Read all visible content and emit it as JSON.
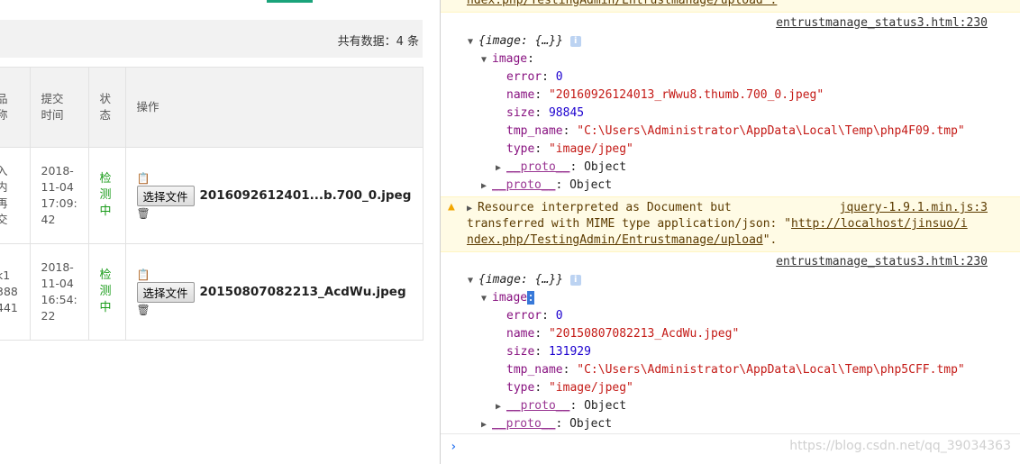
{
  "left": {
    "total": "共有数据：4 条",
    "headers": [
      {
        "l1": "品",
        "l2": "称"
      },
      {
        "l1": "提交",
        "l2": "时间"
      },
      {
        "l1": "状",
        "l2": "态"
      },
      {
        "l1": "操作"
      }
    ],
    "rows": [
      {
        "c0": [
          "入",
          "内",
          "再",
          "交"
        ],
        "time": [
          "2018-",
          "11-04",
          "17:09:",
          "42"
        ],
        "status": [
          "检",
          "测",
          "中"
        ],
        "button": "选择文件",
        "file": "2016092612401...b.700_0.jpeg"
      },
      {
        "c0": [
          "k1",
          "388",
          "441"
        ],
        "time": [
          "2018-",
          "11-04",
          "16:54:",
          "22"
        ],
        "status": [
          "检",
          "测",
          "中"
        ],
        "button": "选择文件",
        "file": "20150807082213_AcdWu.jpeg"
      }
    ]
  },
  "console": {
    "top_partial": "ndex.php/TestingAdmin/Entrustmanage/upload\".",
    "entries": [
      {
        "source": "entrustmanage_status3.html:230",
        "object_label": "{image: {…}}",
        "image_key": "image",
        "error_key": "error",
        "error": "0",
        "name_key": "name",
        "name": "\"20160926124013_rWwu8.thumb.700_0.jpeg\"",
        "size_key": "size",
        "size": "98845",
        "tmp_key": "tmp_name",
        "tmp": "\"C:\\Users\\Administrator\\AppData\\Local\\Temp\\php4F09.tmp\"",
        "type_key": "type",
        "type": "\"image/jpeg\"",
        "proto_inner": "__proto__",
        "proto_outer": "__proto__",
        "proto_value": "Object"
      },
      {
        "source": "entrustmanage_status3.html:230",
        "object_label": "{image: {…}}",
        "image_key": "image",
        "error_key": "error",
        "error": "0",
        "name_key": "name",
        "name": "\"20150807082213_AcdWu.jpeg\"",
        "size_key": "size",
        "size": "131929",
        "tmp_key": "tmp_name",
        "tmp": "\"C:\\Users\\Administrator\\AppData\\Local\\Temp\\php5CFF.tmp\"",
        "type_key": "type",
        "type": "\"image/jpeg\"",
        "proto_inner": "__proto__",
        "proto_outer": "__proto__",
        "proto_value": "Object"
      }
    ],
    "warning": {
      "line1": "Resource interpreted as Document but",
      "source": "jquery-1.9.1.min.js:3",
      "line2a": "transferred with MIME type application/json: \"",
      "link1": "http://localhost/jinsuo/i",
      "link2": "ndex.php/TestingAdmin/Entrustmanage/upload",
      "line3b": "\"."
    },
    "prompt": "›",
    "watermark": "https://blog.csdn.net/qq_39034363"
  }
}
